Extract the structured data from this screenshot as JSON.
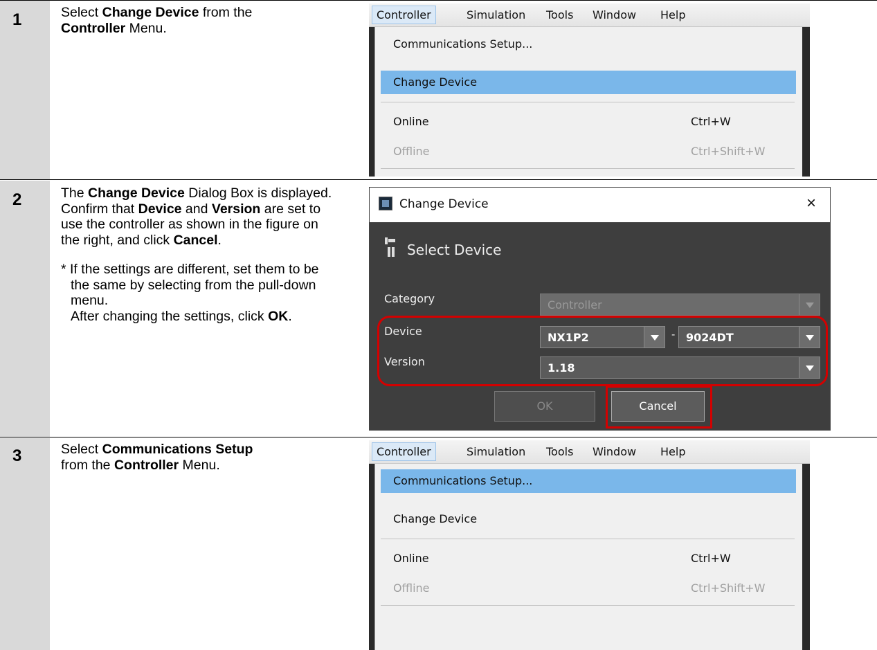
{
  "steps": [
    {
      "number": "1",
      "description": {
        "pre": "Select ",
        "b1": "Change Device",
        "mid": " from the ",
        "b2": "Controller",
        "post": " Menu."
      }
    },
    {
      "number": "2",
      "description": {
        "l1_pre": "The ",
        "l1_b": "Change Device",
        "l1_post": " Dialog Box is displayed.",
        "l2_pre": "Confirm that ",
        "l2_b1": "Device",
        "l2_mid": " and ",
        "l2_b2": "Version",
        "l2_post": " are set to use the controller as shown in the figure on the right, and click ",
        "l2_b3": "Cancel",
        "l2_end": ".",
        "note_text": "* If the settings are different, set them to be the same by selecting from the pull-down menu.",
        "note2_pre": "After changing the settings, click ",
        "note2_b": "OK",
        "note2_end": "."
      }
    },
    {
      "number": "3",
      "description": {
        "pre": "Select ",
        "b1": "Communications Setup",
        "mid": " from the ",
        "b2": "Controller",
        "post": " Menu."
      }
    }
  ],
  "menubar": [
    "Controller",
    "Simulation",
    "Tools",
    "Window",
    "Help"
  ],
  "menu_items": {
    "communications_setup": "Communications Setup...",
    "change_device": "Change Device",
    "online": "Online",
    "online_shortcut": "Ctrl+W",
    "offline": "Offline",
    "offline_shortcut": "Ctrl+Shift+W"
  },
  "dialog": {
    "title": "Change Device",
    "close": "×",
    "section_title": "Select Device",
    "category_label": "Category",
    "category_value": "Controller",
    "device_label": "Device",
    "device_value": "NX1P2",
    "device_sep": "-",
    "device_variant": "9024DT",
    "version_label": "Version",
    "version_value": "1.18",
    "ok_label": "OK",
    "cancel_label": "Cancel"
  },
  "colors": {
    "highlight_red": "#d40000",
    "menu_selected": "#7ab7ea",
    "step_column": "#d9d9d9"
  }
}
